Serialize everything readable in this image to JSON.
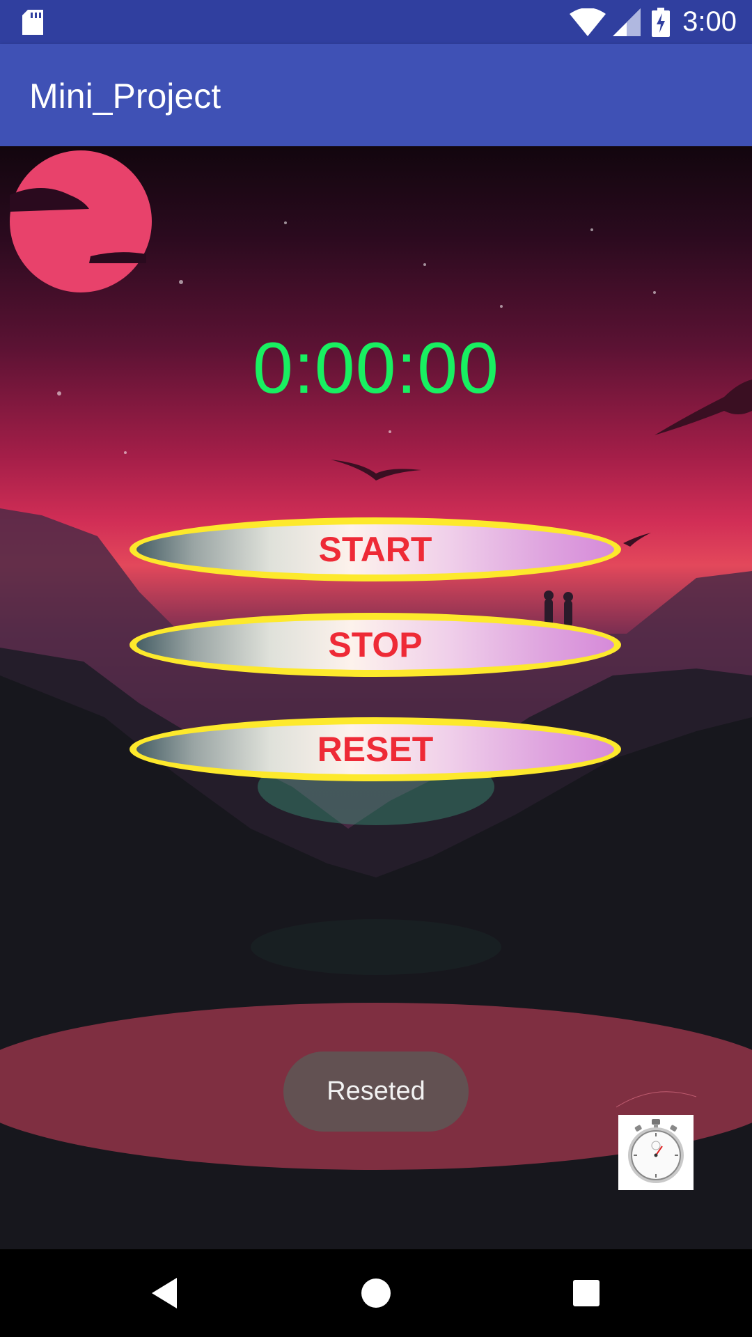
{
  "status_bar": {
    "time": "3:00",
    "icons": [
      "sd-card-icon",
      "wifi-icon",
      "signal-icon",
      "battery-charging-icon"
    ]
  },
  "app_bar": {
    "title": "Mini_Project"
  },
  "timer": {
    "display": "0:00:00",
    "color": "#18f061"
  },
  "buttons": {
    "start_label": "START",
    "stop_label": "STOP",
    "reset_label": "RESET",
    "label_color": "#ee2a36",
    "border_color": "#fde92c"
  },
  "toast": {
    "message": "Reseted"
  },
  "corner_image": {
    "icon": "stopwatch-icon"
  },
  "nav_bar": {
    "icons": [
      "back-icon",
      "home-icon",
      "recents-icon"
    ]
  },
  "colors": {
    "status_bar": "#303f9f",
    "app_bar": "#3f51b5"
  }
}
